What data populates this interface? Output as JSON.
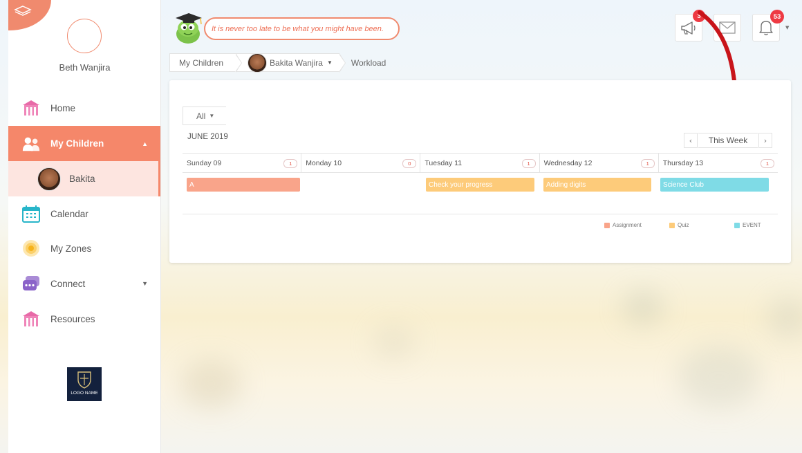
{
  "app": {
    "quote": "It is never too late to be what you might have been."
  },
  "sidebar": {
    "profile_name": "Beth Wanjira",
    "items": [
      {
        "label": "Home",
        "icon": "school-building-icon"
      },
      {
        "label": "My Children",
        "icon": "children-icon",
        "active": true
      },
      {
        "label": "Calendar",
        "icon": "calendar-icon"
      },
      {
        "label": "My Zones",
        "icon": "zones-icon"
      },
      {
        "label": "Connect",
        "icon": "connect-icon"
      },
      {
        "label": "Resources",
        "icon": "resources-icon"
      }
    ],
    "sub_item": "Bakita",
    "logo_text": "LOGO NAME"
  },
  "header": {
    "announcements_count": "3",
    "notifications_count": "53"
  },
  "breadcrumb": {
    "level1": "My Children",
    "level2": "Bakita Wanjira",
    "level3": "Workload"
  },
  "workload": {
    "filter": "All",
    "month": "JUNE 2019",
    "week_label": "This Week",
    "prev": "‹",
    "next": "›",
    "days": [
      {
        "label": "Sunday 09",
        "count": "1"
      },
      {
        "label": "Monday 10",
        "count": "0"
      },
      {
        "label": "Tuesday 11",
        "count": "1"
      },
      {
        "label": "Wednesday 12",
        "count": "1"
      },
      {
        "label": "Thursday 13",
        "count": "1"
      }
    ],
    "events": [
      {
        "title": "A",
        "type": "Assignment"
      },
      {
        "title": "Check your progress",
        "type": "Quiz"
      },
      {
        "title": "Adding digits",
        "type": "Quiz"
      },
      {
        "title": "Science Club",
        "type": "EVENT"
      }
    ],
    "legend": [
      {
        "label": "Assignment",
        "color": "#f9a48a"
      },
      {
        "label": "Quiz",
        "color": "#fdcb7a"
      },
      {
        "label": "EVENT",
        "color": "#7fdbe6"
      }
    ]
  },
  "colors": {
    "accent": "#f5876a",
    "badge": "#ee3a43",
    "assignment": "#f9a48a",
    "quiz": "#fdcb7a",
    "event": "#7fdbe6"
  }
}
